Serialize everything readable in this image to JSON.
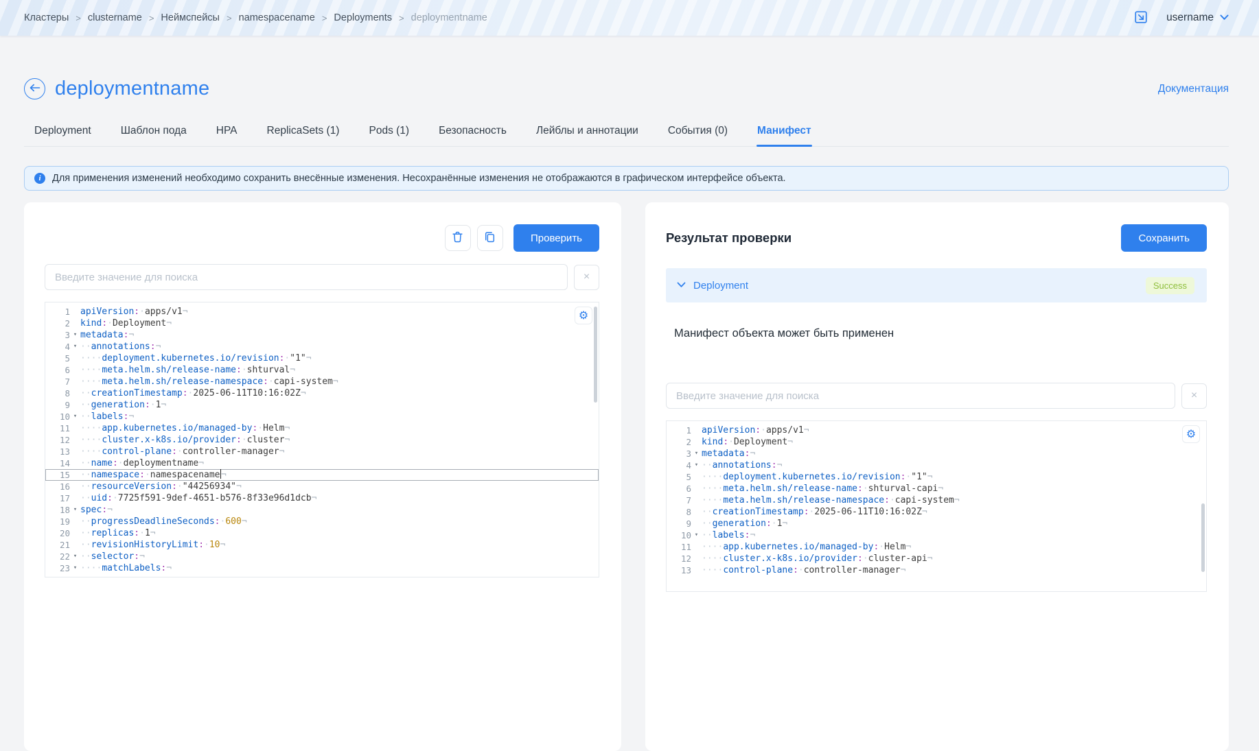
{
  "header": {
    "breadcrumb": [
      "Кластеры",
      "clustername",
      "Неймспейсы",
      "namespacename",
      "Deployments",
      "deploymentname"
    ],
    "separator": ">",
    "username": "username"
  },
  "page": {
    "title": "deploymentname",
    "doc_link": "Документация"
  },
  "tabs": [
    {
      "label": "Deployment",
      "active": false
    },
    {
      "label": "Шаблон пода",
      "active": false
    },
    {
      "label": "HPA",
      "active": false
    },
    {
      "label": "ReplicaSets (1)",
      "active": false
    },
    {
      "label": "Pods (1)",
      "active": false
    },
    {
      "label": "Безопасность",
      "active": false
    },
    {
      "label": "Лейблы и аннотации",
      "active": false
    },
    {
      "label": "События (0)",
      "active": false
    },
    {
      "label": "Манифест",
      "active": true
    }
  ],
  "banner": {
    "text": "Для применения изменений необходимо сохранить внесённые изменения. Несохранённые изменения не отображаются в графическом интерфейсе объекта."
  },
  "left_panel": {
    "check_button": "Проверить",
    "search": {
      "placeholder": "Введите значение для поиска",
      "clear": "×"
    },
    "editor": {
      "active_line": 15,
      "lines": [
        {
          "n": 1,
          "indent": 0,
          "fold": false,
          "key": "apiVersion",
          "value": "apps/v1",
          "vt": "v"
        },
        {
          "n": 2,
          "indent": 0,
          "fold": false,
          "key": "kind",
          "value": "Deployment",
          "vt": "v"
        },
        {
          "n": 3,
          "indent": 0,
          "fold": true,
          "key": "metadata",
          "value": null
        },
        {
          "n": 4,
          "indent": 1,
          "fold": true,
          "key": "annotations",
          "value": null
        },
        {
          "n": 5,
          "indent": 2,
          "fold": false,
          "key": "deployment.kubernetes.io/revision",
          "value": "\"1\"",
          "vt": "v"
        },
        {
          "n": 6,
          "indent": 2,
          "fold": false,
          "key": "meta.helm.sh/release-name",
          "value": "shturval",
          "vt": "v"
        },
        {
          "n": 7,
          "indent": 2,
          "fold": false,
          "key": "meta.helm.sh/release-namespace",
          "value": "capi-system",
          "vt": "v"
        },
        {
          "n": 8,
          "indent": 1,
          "fold": false,
          "key": "creationTimestamp",
          "value": "2025-06-11T10:16:02Z",
          "vt": "v"
        },
        {
          "n": 9,
          "indent": 1,
          "fold": false,
          "key": "generation",
          "value": "1",
          "vt": "v"
        },
        {
          "n": 10,
          "indent": 1,
          "fold": true,
          "key": "labels",
          "value": null
        },
        {
          "n": 11,
          "indent": 2,
          "fold": false,
          "key": "app.kubernetes.io/managed-by",
          "value": "Helm",
          "vt": "v"
        },
        {
          "n": 12,
          "indent": 2,
          "fold": false,
          "key": "cluster.x-k8s.io/provider",
          "value": "cluster",
          "vt": "v"
        },
        {
          "n": 13,
          "indent": 2,
          "fold": false,
          "key": "control-plane",
          "value": "controller-manager",
          "vt": "v"
        },
        {
          "n": 14,
          "indent": 1,
          "fold": false,
          "key": "name",
          "value": "deploymentname",
          "vt": "v"
        },
        {
          "n": 15,
          "indent": 1,
          "fold": false,
          "key": "namespace",
          "value": "namespacename",
          "vt": "v",
          "caret": true
        },
        {
          "n": 16,
          "indent": 1,
          "fold": false,
          "key": "resourceVersion",
          "value": "\"44256934\"",
          "vt": "v"
        },
        {
          "n": 17,
          "indent": 1,
          "fold": false,
          "key": "uid",
          "value": "7725f591-9def-4651-b576-8f33e96d1dcb",
          "vt": "v"
        },
        {
          "n": 18,
          "indent": 0,
          "fold": true,
          "key": "spec",
          "value": null
        },
        {
          "n": 19,
          "indent": 1,
          "fold": false,
          "key": "progressDeadlineSeconds",
          "value": "600",
          "vt": "n"
        },
        {
          "n": 20,
          "indent": 1,
          "fold": false,
          "key": "replicas",
          "value": "1",
          "vt": "v"
        },
        {
          "n": 21,
          "indent": 1,
          "fold": false,
          "key": "revisionHistoryLimit",
          "value": "10",
          "vt": "n"
        },
        {
          "n": 22,
          "indent": 1,
          "fold": true,
          "key": "selector",
          "value": null
        },
        {
          "n": 23,
          "indent": 2,
          "fold": true,
          "key": "matchLabels",
          "value": null
        }
      ]
    }
  },
  "right_panel": {
    "title": "Результат проверки",
    "save_button": "Сохранить",
    "result": {
      "kind": "Deployment",
      "status": "Success",
      "message": "Манифест объекта может быть применен"
    },
    "search": {
      "placeholder": "Введите значение для поиска",
      "clear": "×"
    },
    "editor": {
      "active_line": 0,
      "lines": [
        {
          "n": 1,
          "indent": 0,
          "fold": false,
          "key": "apiVersion",
          "value": "apps/v1",
          "vt": "v"
        },
        {
          "n": 2,
          "indent": 0,
          "fold": false,
          "key": "kind",
          "value": "Deployment",
          "vt": "v"
        },
        {
          "n": 3,
          "indent": 0,
          "fold": true,
          "key": "metadata",
          "value": null
        },
        {
          "n": 4,
          "indent": 1,
          "fold": true,
          "key": "annotations",
          "value": null
        },
        {
          "n": 5,
          "indent": 2,
          "fold": false,
          "key": "deployment.kubernetes.io/revision",
          "value": "\"1\"",
          "vt": "v"
        },
        {
          "n": 6,
          "indent": 2,
          "fold": false,
          "key": "meta.helm.sh/release-name",
          "value": "shturval-capi",
          "vt": "v"
        },
        {
          "n": 7,
          "indent": 2,
          "fold": false,
          "key": "meta.helm.sh/release-namespace",
          "value": "capi-system",
          "vt": "v"
        },
        {
          "n": 8,
          "indent": 1,
          "fold": false,
          "key": "creationTimestamp",
          "value": "2025-06-11T10:16:02Z",
          "vt": "v"
        },
        {
          "n": 9,
          "indent": 1,
          "fold": false,
          "key": "generation",
          "value": "1",
          "vt": "v"
        },
        {
          "n": 10,
          "indent": 1,
          "fold": true,
          "key": "labels",
          "value": null
        },
        {
          "n": 11,
          "indent": 2,
          "fold": false,
          "key": "app.kubernetes.io/managed-by",
          "value": "Helm",
          "vt": "v"
        },
        {
          "n": 12,
          "indent": 2,
          "fold": false,
          "key": "cluster.x-k8s.io/provider",
          "value": "cluster-api",
          "vt": "v"
        },
        {
          "n": 13,
          "indent": 2,
          "fold": false,
          "key": "control-plane",
          "value": "controller-manager",
          "vt": "v"
        }
      ]
    }
  },
  "icons": {
    "fold": "▾",
    "eol": "¬",
    "space_dot": "·",
    "gear": "⚙"
  },
  "colors": {
    "accent": "#2f80ed",
    "success_bg": "#eef8d9",
    "success_text": "#8ebe3b",
    "yaml_key": "#0d5fc4",
    "yaml_number": "#b8860b"
  }
}
